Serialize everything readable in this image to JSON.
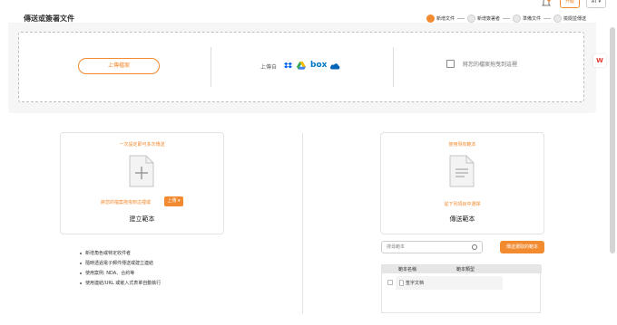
{
  "header": {
    "title": "傳送或簽署文件",
    "upgrade_label": "升級",
    "avatar_label": "AT ▾"
  },
  "steps": [
    {
      "label": "新增文件",
      "active": true
    },
    {
      "label": "新增簽署者",
      "active": false
    },
    {
      "label": "準備文件",
      "active": false
    },
    {
      "label": "檢閱並傳送",
      "active": false
    }
  ],
  "upload": {
    "upload_button": "上傳檔案",
    "upload_from": "上傳自",
    "cloud_services": [
      "dropbox-icon",
      "google-drive-icon",
      "box-icon",
      "onedrive-icon"
    ],
    "box_text": "box",
    "drag_text": "將您的檔案拖曳到這裡"
  },
  "create_template": {
    "hint": "一次設定即可多次傳送",
    "drag_text": "將您的檔案拖曳到這裡或",
    "upload_label": "上傳 ▾",
    "title": "建立範本",
    "features": [
      "新增角色或特定收件者",
      "隨時透過電子郵件傳送或建立連結",
      "使用案例: NDA、合約等",
      "使用連結/URL 或嵌入式表單自動執行"
    ]
  },
  "send_template": {
    "hint": "使用現有範本",
    "select_text": "從下列項目中選擇",
    "title": "傳送範本",
    "search_placeholder": "搜尋範本",
    "send_selected_button": "傳送選取的範本",
    "table_headers": [
      "範本名稱",
      "範本類型"
    ],
    "rows": [
      {
        "name": "签字文档",
        "type": ""
      }
    ]
  },
  "colors": {
    "accent": "#f28a2f"
  }
}
